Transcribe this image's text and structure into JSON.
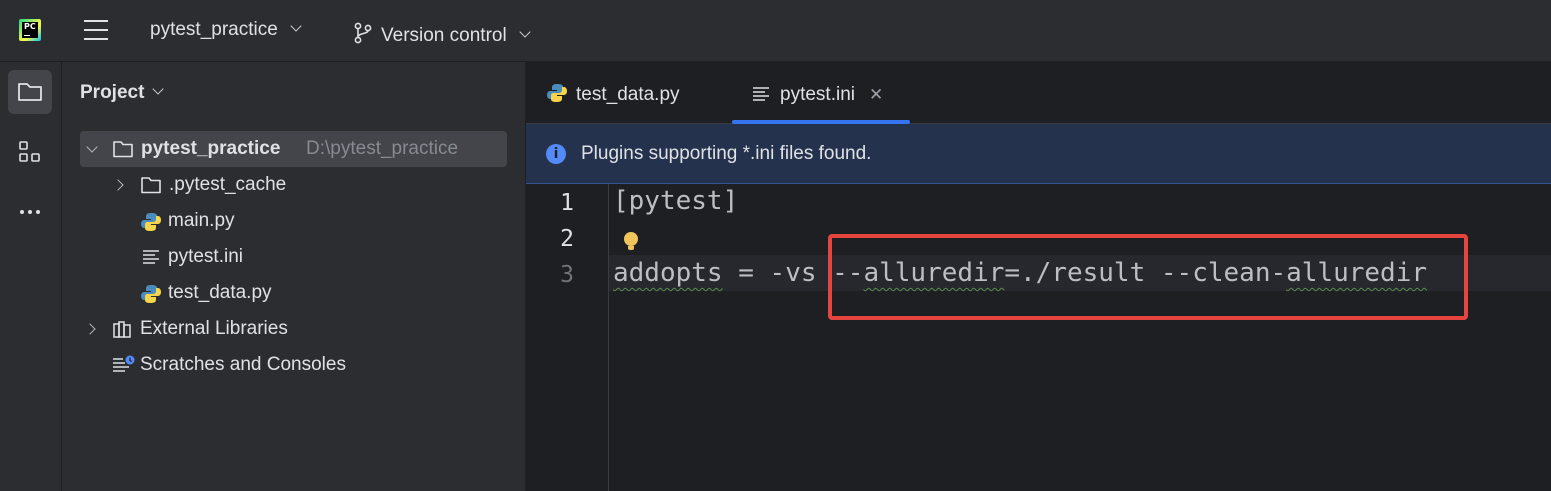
{
  "topbar": {
    "logo_text": "PC",
    "project_name": "pytest_practice",
    "vcs_label": "Version control"
  },
  "project_panel": {
    "title": "Project",
    "tree": [
      {
        "label": "pytest_practice",
        "path": "D:\\pytest_practice",
        "type": "folder",
        "expanded": true
      },
      {
        "label": ".pytest_cache",
        "type": "folder",
        "expanded": false
      },
      {
        "label": "main.py",
        "type": "python-file"
      },
      {
        "label": "pytest.ini",
        "type": "ini-file"
      },
      {
        "label": "test_data.py",
        "type": "python-file"
      },
      {
        "label": "External Libraries",
        "type": "libraries",
        "expanded": false
      },
      {
        "label": "Scratches and Consoles",
        "type": "scratches"
      }
    ]
  },
  "editor": {
    "tabs": [
      {
        "label": "test_data.py",
        "icon": "python-icon",
        "active": false
      },
      {
        "label": "pytest.ini",
        "icon": "ini-file-icon",
        "active": true
      }
    ],
    "close_glyph": "✕",
    "banner": {
      "text": "Plugins supporting *.ini files found.",
      "icon_glyph": "i"
    },
    "lines": [
      {
        "number": "1",
        "text": "[pytest]"
      },
      {
        "number": "2",
        "text": ""
      },
      {
        "number": "3",
        "text": "addopts = -vs --alluredir=./result --clean-alluredir"
      }
    ],
    "line3_parts": {
      "a": "addopts",
      "b": " = -vs --",
      "c": "alluredir",
      "d": "=./result --clean-",
      "e": "alluredir"
    },
    "highlight_color": "#e5443f"
  }
}
